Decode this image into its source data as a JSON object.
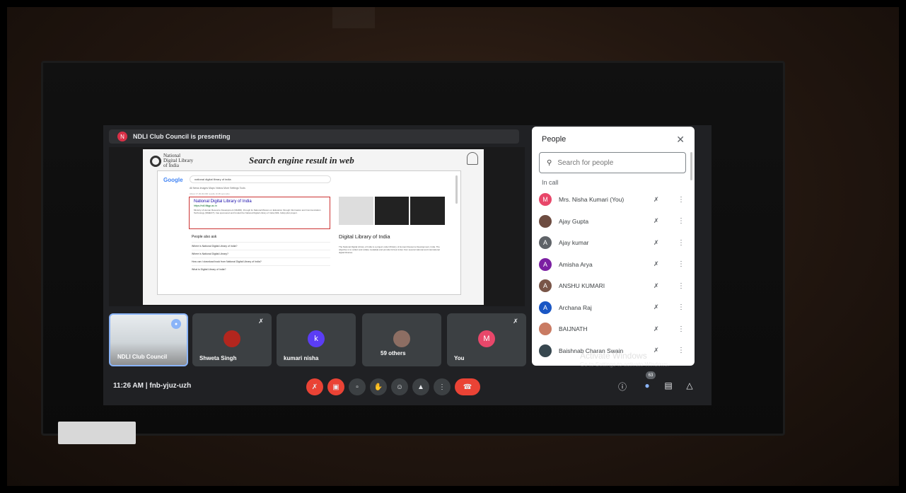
{
  "presenting": {
    "badge": "N",
    "text": "NDLI Club Council is presenting"
  },
  "slide": {
    "logo_lines": [
      "National",
      "Digital Library",
      "of India"
    ],
    "title": "Search engine result in web",
    "serp": {
      "engine": "Google",
      "query": "national digital library of india",
      "tabs": "All   News   Images   Maps   Videos   More      Settings   Tools",
      "stats": "About 17,30,00,000 results (0.48 seconds)",
      "result_title": "National Digital Library of India",
      "result_url": "https://ndl.iitkgp.ac.in",
      "result_snippet": "Ministry of Human Resource Development (MHRD), through its National Mission on Education through Information and Communication Technology (NMEICT), has sponsored and funded the National Digital Library of India (NDL India) pilot project.",
      "paa_heading": "People also ask",
      "paa": [
        "Where is National Digital Library of India?",
        "Where is National Digital Library?",
        "How can I download book from National Digital Library of India?",
        "What is Digital Library of India?"
      ],
      "kp_title": "Digital Library of India",
      "kp_desc": "The National Digital Library of India is a project under Ministry of Human Resource Development, India. The objective is to collect and collate metadata and provide full text index from several national and international digital libraries."
    }
  },
  "tiles": [
    {
      "name": "NDLI Club Council",
      "type": "room"
    },
    {
      "name": "Shweta Singh",
      "type": "photo",
      "color": "#b3261e"
    },
    {
      "name": "kumari nisha",
      "type": "letter",
      "letter": "k",
      "color": "#5b3df5"
    },
    {
      "name": "59 others",
      "type": "group",
      "color": "#8d6e63"
    },
    {
      "name": "You",
      "type": "letter",
      "letter": "M",
      "color": "#e8476a"
    }
  ],
  "controls": {
    "time": "11:26 AM",
    "separator": "|",
    "meeting_code": "fnb-yjuz-uzh",
    "participants_count": "63"
  },
  "people": {
    "title": "People",
    "search_placeholder": "Search for people",
    "section": "In call",
    "list": [
      {
        "name": "Mrs. Nisha Kumari (You)",
        "letter": "M",
        "color": "#e8476a"
      },
      {
        "name": "Ajay Gupta",
        "letter": "",
        "color": "#6d4c41"
      },
      {
        "name": "Ajay kumar",
        "letter": "A",
        "color": "#5f6368"
      },
      {
        "name": "Amisha Arya",
        "letter": "A",
        "color": "#7b1fa2"
      },
      {
        "name": "ANSHU KUMARI",
        "letter": "A",
        "color": "#795548"
      },
      {
        "name": "Archana Raj",
        "letter": "A",
        "color": "#1a56c4"
      },
      {
        "name": "BAIJNATH",
        "letter": "",
        "color": "#c97b63"
      },
      {
        "name": "Baishnab Charan Swain",
        "letter": "",
        "color": "#37474f"
      }
    ]
  },
  "watermark": {
    "title": "Activate Windows",
    "sub": "Go to Settings to activate Windows."
  }
}
